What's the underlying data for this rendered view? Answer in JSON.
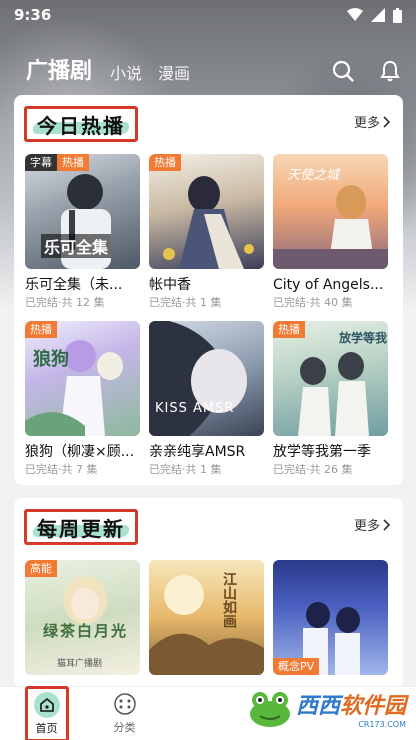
{
  "status_bar": {
    "time": "9:36"
  },
  "top_nav": {
    "tabs": [
      {
        "label": "广播剧",
        "active": true
      },
      {
        "label": "小说",
        "active": false
      },
      {
        "label": "漫画",
        "active": false
      }
    ]
  },
  "hot_section": {
    "title": "今日热播",
    "more": "更多",
    "items": [
      {
        "title": "乐可全集（未...",
        "subtitle": "已完结·共 12 集",
        "badges": [
          "字幕",
          "热播"
        ],
        "cover_text": "乐可全集"
      },
      {
        "title": "帐中香",
        "subtitle": "已完结·共 1 集",
        "badges": [
          "热播"
        ],
        "cover_text": ""
      },
      {
        "title": "City of Angels...",
        "subtitle": "已完结·共 40 集",
        "badges": [],
        "cover_text": "天使之城"
      },
      {
        "title": "狼狗（柳凄×顾...",
        "subtitle": "已完结·共 7 集",
        "badges": [
          "热播"
        ],
        "cover_text": "狼狗"
      },
      {
        "title": "亲亲纯享AMSR",
        "subtitle": "已完结·共 1 集",
        "badges": [],
        "cover_text": "KISS AMSR"
      },
      {
        "title": "放学等我第一季",
        "subtitle": "已完结·共 26 集",
        "badges": [
          "热播"
        ],
        "cover_text": "放学等我"
      }
    ]
  },
  "weekly_section": {
    "title": "每周更新",
    "more": "更多",
    "items": [
      {
        "badge": "高能",
        "cover_text": "绿茶白月光",
        "cover_sub": "猫耳广播剧"
      },
      {
        "badge": "",
        "cover_text": "江山如画"
      },
      {
        "badge_bottom": "概念PV",
        "cover_text": ""
      }
    ]
  },
  "bottom_nav": {
    "items": [
      {
        "label": "首页",
        "icon": "home-icon",
        "active": true
      },
      {
        "label": "分类",
        "icon": "category-icon",
        "active": false
      }
    ]
  },
  "watermark": {
    "brand": "西西",
    "brand2": "软件园",
    "url": "CR173.COM"
  },
  "colors": {
    "highlight_red": "#d43a2a",
    "brush_mint": "#a9e0cf",
    "badge_orange": "#f27a33"
  }
}
